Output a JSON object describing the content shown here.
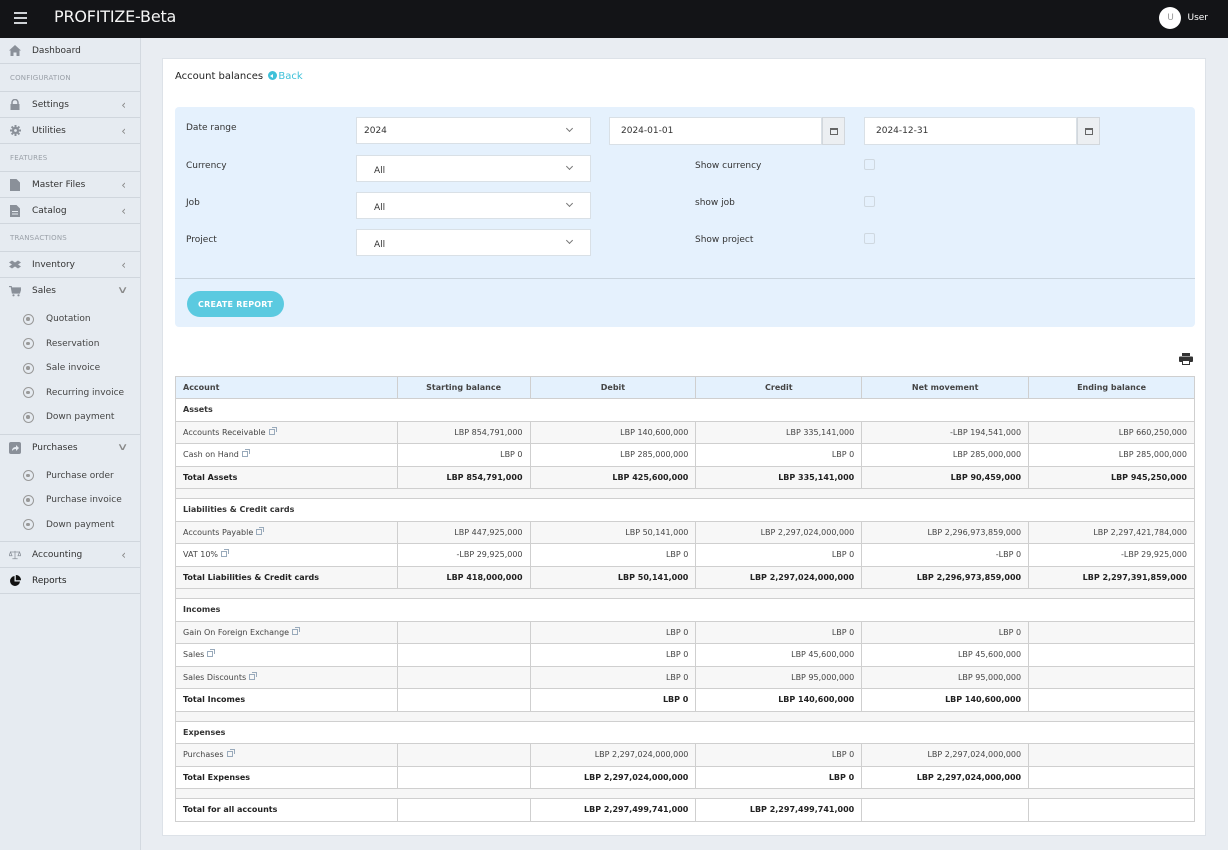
{
  "app": {
    "title": "PROFITIZE-Beta",
    "user": {
      "initial": "U",
      "name": "User"
    }
  },
  "sidebar": {
    "dashboard": "Dashboard",
    "sections": {
      "configuration": "CONFIGURATION",
      "features": "FEATURES",
      "transactions": "TRANSACTIONS"
    },
    "settings": "Settings",
    "utilities": "Utilities",
    "master_files": "Master Files",
    "catalog": "Catalog",
    "inventory": "Inventory",
    "sales": "Sales",
    "sales_items": [
      "Quotation",
      "Reservation",
      "Sale invoice",
      "Recurring invoice",
      "Down payment"
    ],
    "purchases": "Purchases",
    "purchases_items": [
      "Purchase order",
      "Purchase invoice",
      "Down payment"
    ],
    "accounting": "Accounting",
    "reports": "Reports"
  },
  "page": {
    "title": "Account balances",
    "back_label": "Back"
  },
  "filters": {
    "date_range_label": "Date range",
    "date_range_value": "2024",
    "date_from": "2024-01-01",
    "date_to": "2024-12-31",
    "currency_label": "Currency",
    "currency_value": "All",
    "job_label": "Job",
    "job_value": "All",
    "project_label": "Project",
    "project_value": "All",
    "show_currency_label": "Show currency",
    "show_job_label": "show job",
    "show_project_label": "Show project",
    "show_currency_checked": false,
    "show_job_checked": false,
    "show_project_checked": false,
    "create_report_label": "CREATE REPORT"
  },
  "table": {
    "headers": [
      "Account",
      "Starting balance",
      "Debit",
      "Credit",
      "Net movement",
      "Ending balance"
    ],
    "groups": [
      {
        "name": "Assets",
        "rows": [
          [
            "Accounts Receivable",
            "LBP 854,791,000",
            "LBP 140,600,000",
            "LBP 335,141,000",
            "-LBP 194,541,000",
            "LBP 660,250,000"
          ],
          [
            "Cash on Hand",
            "LBP 0",
            "LBP 285,000,000",
            "LBP 0",
            "LBP 285,000,000",
            "LBP 285,000,000"
          ]
        ],
        "total": [
          "Total Assets",
          "LBP 854,791,000",
          "LBP 425,600,000",
          "LBP 335,141,000",
          "LBP 90,459,000",
          "LBP 945,250,000"
        ]
      },
      {
        "name": "Liabilities & Credit cards",
        "rows": [
          [
            "Accounts Payable",
            "LBP 447,925,000",
            "LBP 50,141,000",
            "LBP 2,297,024,000,000",
            "LBP 2,296,973,859,000",
            "LBP 2,297,421,784,000"
          ],
          [
            "VAT 10%",
            "-LBP 29,925,000",
            "LBP 0",
            "LBP 0",
            "-LBP 0",
            "-LBP 29,925,000"
          ]
        ],
        "total": [
          "Total Liabilities & Credit cards",
          "LBP 418,000,000",
          "LBP 50,141,000",
          "LBP 2,297,024,000,000",
          "LBP 2,296,973,859,000",
          "LBP 2,297,391,859,000"
        ]
      },
      {
        "name": "Incomes",
        "rows": [
          [
            "Gain On Foreign Exchange",
            "",
            "LBP 0",
            "LBP 0",
            "LBP 0",
            ""
          ],
          [
            "Sales",
            "",
            "LBP 0",
            "LBP 45,600,000",
            "LBP 45,600,000",
            ""
          ],
          [
            "Sales Discounts",
            "",
            "LBP 0",
            "LBP 95,000,000",
            "LBP 95,000,000",
            ""
          ]
        ],
        "total": [
          "Total Incomes",
          "",
          "LBP 0",
          "LBP 140,600,000",
          "LBP 140,600,000",
          ""
        ]
      },
      {
        "name": "Expenses",
        "rows": [
          [
            "Purchases",
            "",
            "LBP 2,297,024,000,000",
            "LBP 0",
            "LBP 2,297,024,000,000",
            ""
          ]
        ],
        "total": [
          "Total Expenses",
          "",
          "LBP 2,297,024,000,000",
          "LBP 0",
          "LBP 2,297,024,000,000",
          ""
        ]
      }
    ],
    "grand_total": [
      "Total for all accounts",
      "",
      "LBP 2,297,499,741,000",
      "LBP 2,297,499,741,000",
      "",
      ""
    ]
  }
}
